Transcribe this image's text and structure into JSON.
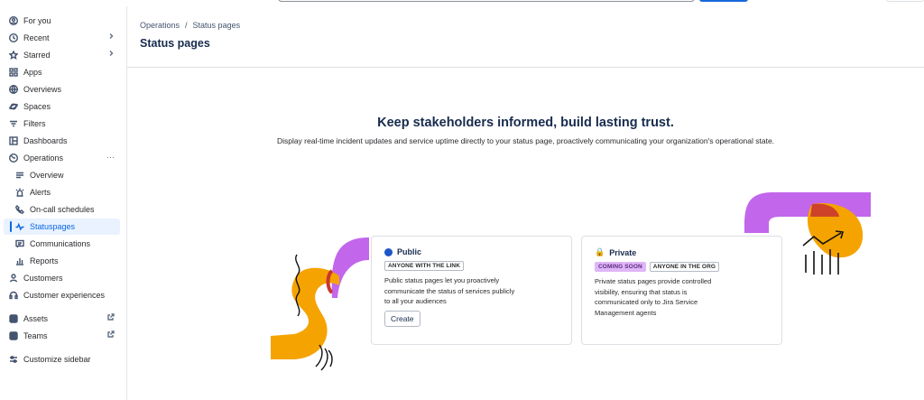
{
  "sidebar": {
    "items": [
      {
        "label": "For you"
      },
      {
        "label": "Recent"
      },
      {
        "label": "Starred"
      },
      {
        "label": "Apps"
      },
      {
        "label": "Overviews"
      },
      {
        "label": "Spaces"
      },
      {
        "label": "Filters"
      },
      {
        "label": "Dashboards"
      },
      {
        "label": "Operations"
      },
      {
        "label": "Overview"
      },
      {
        "label": "Alerts"
      },
      {
        "label": "On-call schedules"
      },
      {
        "label": "Statuspages"
      },
      {
        "label": "Communications"
      },
      {
        "label": "Reports"
      },
      {
        "label": "Customers"
      },
      {
        "label": "Customer experiences"
      },
      {
        "label": "Assets"
      },
      {
        "label": "Teams"
      },
      {
        "label": "Customize sidebar"
      }
    ],
    "more_label": "···"
  },
  "breadcrumb": {
    "parent": "Operations",
    "separator": "/",
    "current": "Status pages"
  },
  "page_title": "Status pages",
  "hero": {
    "title": "Keep stakeholders informed, build lasting trust.",
    "subtitle": "Display real-time incident updates and service uptime directly to your status page, proactively communicating your organization's operational state."
  },
  "cards": {
    "public": {
      "title": "Public",
      "badge": "ANYONE WITH THE LINK",
      "desc": "Public status pages let you proactively communicate the status of services publicly to all your audiences",
      "button": "Create"
    },
    "private": {
      "title": "Private",
      "badge_soon": "COMING SOON",
      "badge": "ANYONE IN THE ORG",
      "desc": "Private status pages provide controlled visibility, ensuring that status is communicated only to Jira Service Management agents"
    }
  },
  "colors": {
    "accent": "#0c66e4",
    "purple": "#c266ec",
    "orange": "#f5a300",
    "red": "#c9372c"
  }
}
